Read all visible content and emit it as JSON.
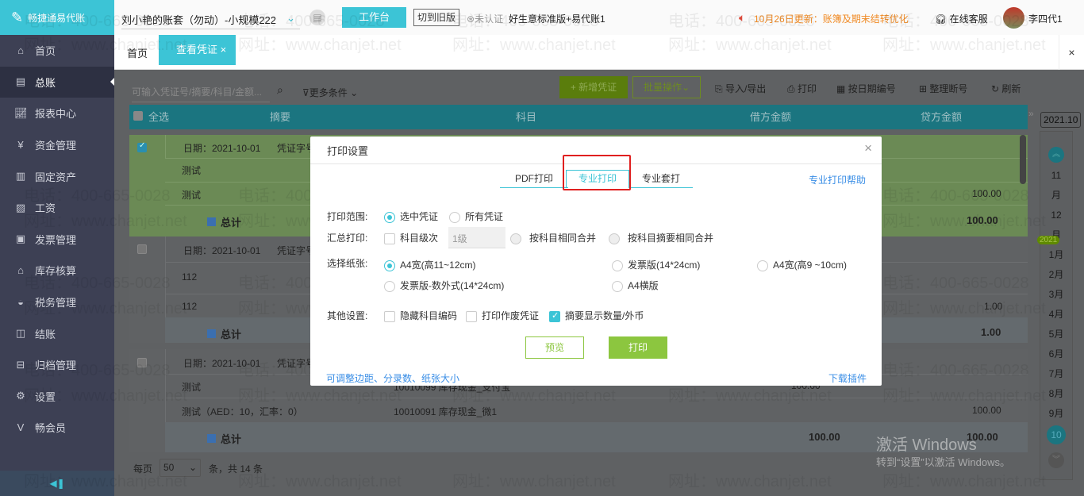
{
  "app": {
    "logo": "畅捷通易代账",
    "account": "刘小艳的账套（勿动）-小规模222",
    "workbench": "工作台",
    "old_version": "切到旧版",
    "cert": "未认证",
    "edition": "好生意标准版+易代账1",
    "notice": "10月26日更新：账簿及期末结转优化",
    "service": "在线客服",
    "user": "李四代1"
  },
  "sidebar": {
    "items": [
      {
        "label": "首页",
        "icon": "home-icon"
      },
      {
        "label": "总账",
        "icon": "ledger-icon"
      },
      {
        "label": "报表中心",
        "icon": "chart-icon"
      },
      {
        "label": "资金管理",
        "icon": "money-bag-icon"
      },
      {
        "label": "固定资产",
        "icon": "building-icon"
      },
      {
        "label": "工资",
        "icon": "salary-icon"
      },
      {
        "label": "发票管理",
        "icon": "invoice-icon"
      },
      {
        "label": "库存核算",
        "icon": "warehouse-icon"
      },
      {
        "label": "税务管理",
        "icon": "tax-icon"
      },
      {
        "label": "结账",
        "icon": "checkout-icon"
      },
      {
        "label": "归档管理",
        "icon": "archive-icon"
      },
      {
        "label": "设置",
        "icon": "gear-icon"
      },
      {
        "label": "畅会员",
        "icon": "vip-icon"
      }
    ]
  },
  "tabs": {
    "home": "首页",
    "active": "查看凭证",
    "close": "×"
  },
  "watermark": {
    "phone": "电话：400-665-0028",
    "site": "网址：www.chanjet.net"
  },
  "toolbar": {
    "search_placeholder": "可输入凭证号/摘要/科目/金额...",
    "more": "更多条件",
    "add": "+ 新增凭证",
    "batch": "批量操作",
    "import": "导入/导出",
    "print": "打印",
    "date_number": "按日期编号",
    "renumber": "整理断号",
    "refresh": "刷新"
  },
  "table": {
    "headers": [
      "全选",
      "摘要",
      "科目",
      "借方金额",
      "贷方金额"
    ],
    "groups": [
      {
        "date": "日期：2021-10-01",
        "voucher": "凭证字号",
        "lines": [
          {
            "summary": "测试",
            "credit": ""
          },
          {
            "summary": "测试",
            "credit": "100.00"
          }
        ],
        "total_label": "总计",
        "total": "100.00",
        "checked": true
      },
      {
        "date": "日期：2021-10-01",
        "voucher": "凭证字号",
        "lines": [
          {
            "summary": "112",
            "credit": ""
          },
          {
            "summary": "112",
            "credit": "1.00"
          }
        ],
        "total_label": "总计",
        "total": "1.00",
        "checked": false
      },
      {
        "date": "日期：2021-10-01",
        "voucher": "凭证字号",
        "lines": [
          {
            "summary": "测试",
            "account": "10010099 库存现金_支付宝",
            "debit": "100.00"
          },
          {
            "summary": "测试（AED：10，汇率：0）",
            "account": "10010091 库存现金_微1",
            "credit": "100.00"
          }
        ],
        "total_label": "总计",
        "total_debit": "100.00",
        "total_credit": "100.00",
        "checked": false
      }
    ]
  },
  "pagination": {
    "per_page": "每页",
    "size": "50",
    "total": "条，共 14 条"
  },
  "calendar": {
    "period": "2021.10",
    "year": "2021",
    "months": [
      "11",
      "月",
      "12",
      "月",
      "1月",
      "2月",
      "3月",
      "4月",
      "5月",
      "6月",
      "7月",
      "8月",
      "9月",
      "10"
    ]
  },
  "modal": {
    "title": "打印设置",
    "close": "×",
    "tabs": [
      "PDF打印",
      "专业打印",
      "专业套打"
    ],
    "help": "专业打印帮助",
    "range_label": "打印范围:",
    "range_opts": [
      "选中凭证",
      "所有凭证"
    ],
    "summary_label": "汇总打印:",
    "level_chk": "科目级次",
    "level_val": "1级",
    "merge_opts": [
      "按科目相同合并",
      "按科目摘要相同合并"
    ],
    "paper_label": "选择纸张:",
    "paper_opts": [
      "A4宽(高11~12cm)",
      "发票版(14*24cm)",
      "A4宽(高9 ~10cm)",
      "发票版-数外式(14*24cm)",
      "A4横版"
    ],
    "other_label": "其他设置:",
    "other_opts": [
      "隐藏科目编码",
      "打印作废凭证",
      "摘要显示数量/外币"
    ],
    "preview": "预览",
    "print": "打印",
    "margin_link": "可调整边距、分录数、纸张大小",
    "plugin": "下载插件"
  },
  "windows": {
    "title": "激活 Windows",
    "sub": "转到“设置”以激活 Windows。"
  }
}
